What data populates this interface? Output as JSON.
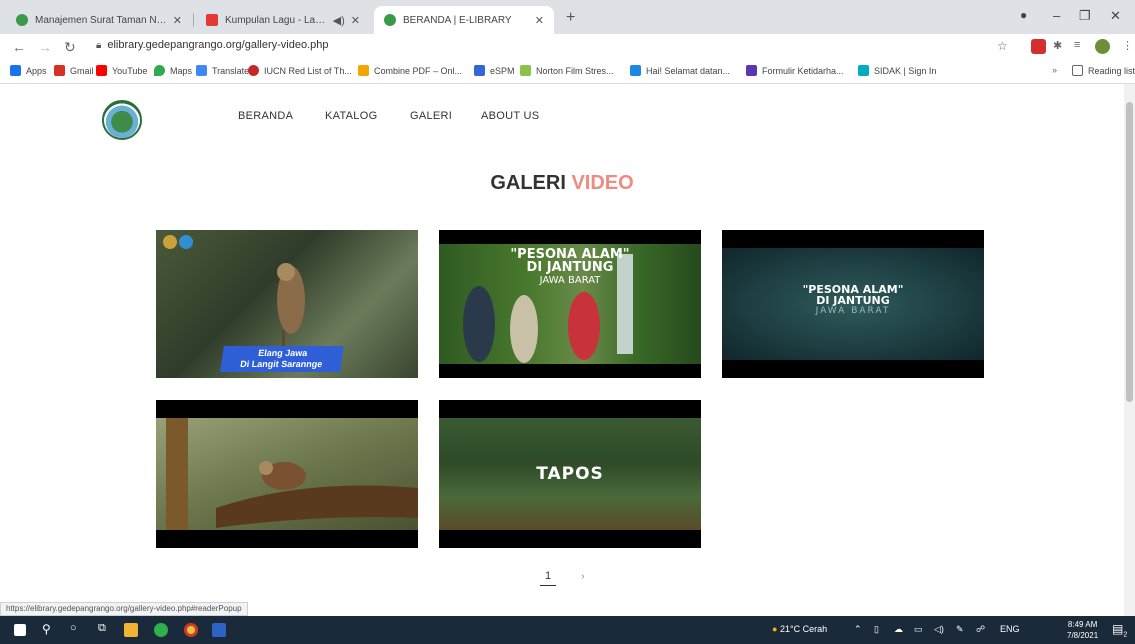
{
  "browser": {
    "tabs": [
      {
        "title": "Manajemen Surat Taman Nasion",
        "favicon_color": "#3a9a4a"
      },
      {
        "title": "Kumpulan Lagu - Lagu Cover",
        "favicon_color": "#e53935"
      },
      {
        "title": "BERANDA | E-LIBRARY",
        "favicon_color": "#3a9a4a"
      }
    ],
    "url": "elibrary.gedepangrango.org/gallery-video.php",
    "bookmarks": [
      {
        "label": "Apps",
        "color": "#1a73e8"
      },
      {
        "label": "Gmail",
        "color": "#d93025"
      },
      {
        "label": "YouTube",
        "color": "#ff0000"
      },
      {
        "label": "Maps",
        "color": "#34a853"
      },
      {
        "label": "Translate",
        "color": "#4285f4"
      },
      {
        "label": "IUCN Red List of Th...",
        "color": "#c62828"
      },
      {
        "label": "Combine PDF – Onl...",
        "color": "#f2a600"
      },
      {
        "label": "eSPM",
        "color": "#3367d6"
      },
      {
        "label": "Norton Film Stres...",
        "color": "#8bc34a"
      },
      {
        "label": "Hai! Selamat datan...",
        "color": "#1e88e5"
      },
      {
        "label": "Formulir Ketidarha...",
        "color": "#5e35b1"
      },
      {
        "label": "SIDAK | Sign In",
        "color": "#00acc1"
      }
    ],
    "reading_list": "Reading list",
    "status_url": "https://elibrary.gedepangrango.org/gallery-video.php#readerPopup"
  },
  "site": {
    "nav": [
      "BERANDA",
      "KATALOG",
      "GALERI",
      "ABOUT US"
    ],
    "heading_part1": "GALERI",
    "heading_part2": "VIDEO",
    "heading_accent": "#f08b82",
    "videos": [
      {
        "caption_line1": "Elang Jawa",
        "caption_line2": "Di Langit Sarannge"
      },
      {
        "title_line1": "\"PESONA ALAM\"",
        "title_line2": "DI JANTUNG",
        "title_line3": "JAWA BARAT"
      },
      {
        "title_line1": "\"PESONA ALAM\"",
        "title_line2": "DI JANTUNG",
        "title_line3": "JAWA BARAT"
      },
      {
        "title": ""
      },
      {
        "title": "TAPOS"
      }
    ],
    "pager_current": "1",
    "pager_next": "›"
  },
  "taskbar": {
    "weather": "21°C Cerah",
    "lang": "ENG",
    "time": "8:49 AM",
    "date": "7/8/2021",
    "notif_count": "2"
  }
}
